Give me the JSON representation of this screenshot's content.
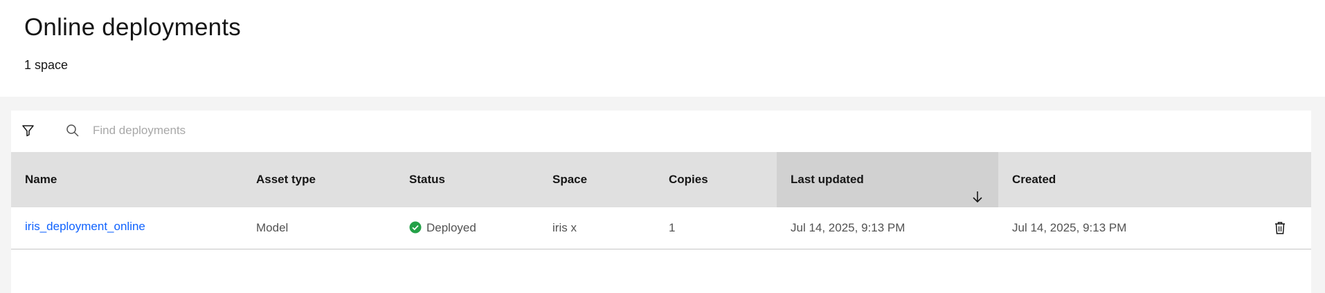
{
  "header": {
    "title": "Online deployments",
    "space_count": "1 space"
  },
  "toolbar": {
    "filter_icon": "filter-icon",
    "search_icon": "search-icon",
    "search_placeholder": "Find deployments",
    "search_value": ""
  },
  "table": {
    "columns": [
      "Name",
      "Asset type",
      "Status",
      "Space",
      "Copies",
      "Last updated",
      "Created"
    ],
    "sorted_column": "Last updated",
    "sort_direction": "descending",
    "rows": [
      {
        "name": "iris_deployment_online",
        "asset_type": "Model",
        "status": "Deployed",
        "status_icon": "checkmark-filled-icon",
        "status_color": "#24a148",
        "space": "iris x",
        "copies": "1",
        "last_updated": "Jul 14, 2025, 9:13 PM",
        "created": "Jul 14, 2025, 9:13 PM",
        "action_icon": "trash-icon"
      }
    ]
  },
  "colors": {
    "link": "#0f62fe",
    "header_bg": "#e0e0e0",
    "sorted_header_bg": "#d1d1d1",
    "page_bg": "#f4f4f4",
    "success": "#24a148"
  }
}
